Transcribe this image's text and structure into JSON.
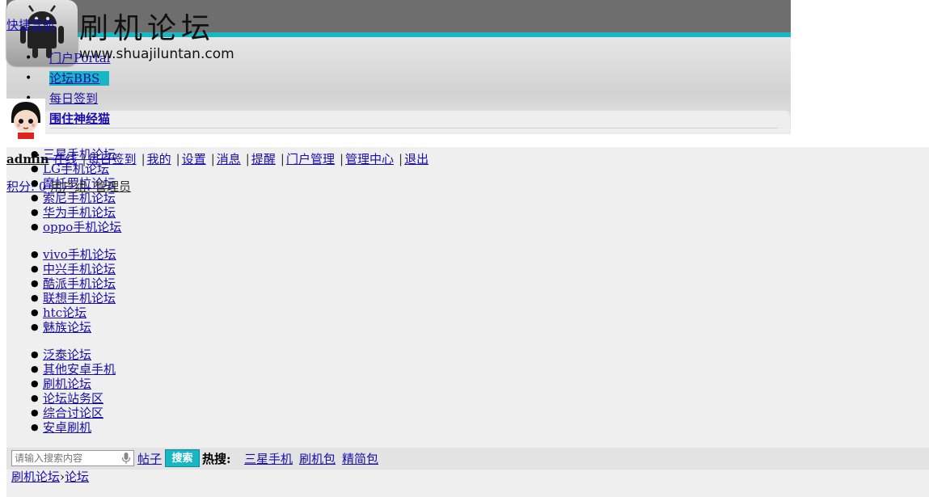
{
  "header": {
    "quick_nav": "快捷导航",
    "logo_title": "刷机论坛",
    "logo_domain": "www.shuajiluntan.com"
  },
  "nav": {
    "items": [
      {
        "label": "门户Portal"
      },
      {
        "label": "论坛BBS"
      },
      {
        "label": "每日签到"
      },
      {
        "label": "围住神经猫"
      }
    ]
  },
  "user_bar": {
    "username": "admin",
    "links": [
      "在线",
      "每日签到",
      "我的",
      "设置",
      "消息",
      "提醒",
      "门户管理",
      "管理中心",
      "退出"
    ],
    "points_label": "积分: 0",
    "user_group": "用户组: 管理员"
  },
  "forums": {
    "group1": [
      "三星手机论坛",
      "LG手机论坛",
      "摩托罗拉论坛",
      "索尼手机论坛",
      "华为手机论坛",
      "oppo手机论坛"
    ],
    "group2": [
      "vivo手机论坛",
      "中兴手机论坛",
      "酷派手机论坛",
      "联想手机论坛",
      "htc论坛",
      "魅族论坛"
    ],
    "group3": [
      "泛泰论坛",
      "其他安卓手机",
      "刷机论坛",
      "论坛站务区",
      "综合讨论区",
      "安卓刷机"
    ]
  },
  "search": {
    "placeholder": "请输入搜索内容",
    "type": "帖子",
    "button": "搜索",
    "hot_label": "热搜:",
    "hot_links": [
      "三星手机",
      "刷机包",
      "精简包"
    ]
  },
  "breadcrumb": {
    "root": "刷机论坛",
    "separator": "›",
    "current": "论坛"
  },
  "colors": {
    "accent": "#19b6c4",
    "header_bar": "#6e6e6e",
    "body_bg": "#efefef"
  },
  "icons": [
    "android-logo-icon",
    "avatar-icon",
    "microphone-icon"
  ]
}
